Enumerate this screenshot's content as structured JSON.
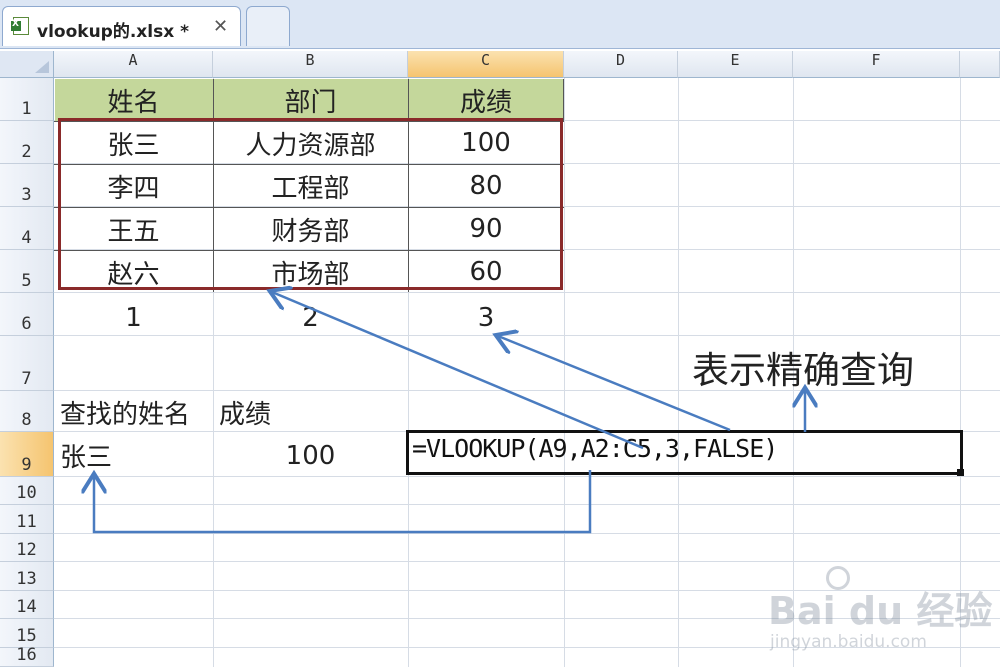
{
  "tab": {
    "title": "vlookup的.xlsx *",
    "close_glyph": "✕",
    "icon": "excel-file-icon"
  },
  "columns": [
    "A",
    "B",
    "C",
    "D",
    "E",
    "F"
  ],
  "rows": [
    "1",
    "2",
    "3",
    "4",
    "5",
    "6",
    "7",
    "8",
    "9",
    "10",
    "11",
    "12",
    "13",
    "14",
    "15",
    "16"
  ],
  "selected": {
    "column": "C",
    "row": "9"
  },
  "table": {
    "headers": [
      "姓名",
      "部门",
      "成绩"
    ],
    "rows": [
      [
        "张三",
        "人力资源部",
        "100"
      ],
      [
        "李四",
        "工程部",
        "80"
      ],
      [
        "王五",
        "财务部",
        "90"
      ],
      [
        "赵六",
        "市场部",
        "60"
      ]
    ],
    "column_numbers": [
      "1",
      "2",
      "3"
    ]
  },
  "lookup": {
    "label_name": "查找的姓名",
    "label_score": "成绩",
    "name_value": "张三",
    "score_value": "100",
    "formula": "=VLOOKUP(A9,A2:C5,3,FALSE)"
  },
  "annotation": {
    "note": "表示精确查询"
  },
  "colors": {
    "header_fill": "#c4d79b",
    "data_box_border": "#8a2a2a",
    "arrow": "#4a7cc0",
    "selected_header": "#f5c46f"
  },
  "watermark": {
    "brand": "Bai du 经验",
    "url": "jingyan.baidu.com"
  }
}
